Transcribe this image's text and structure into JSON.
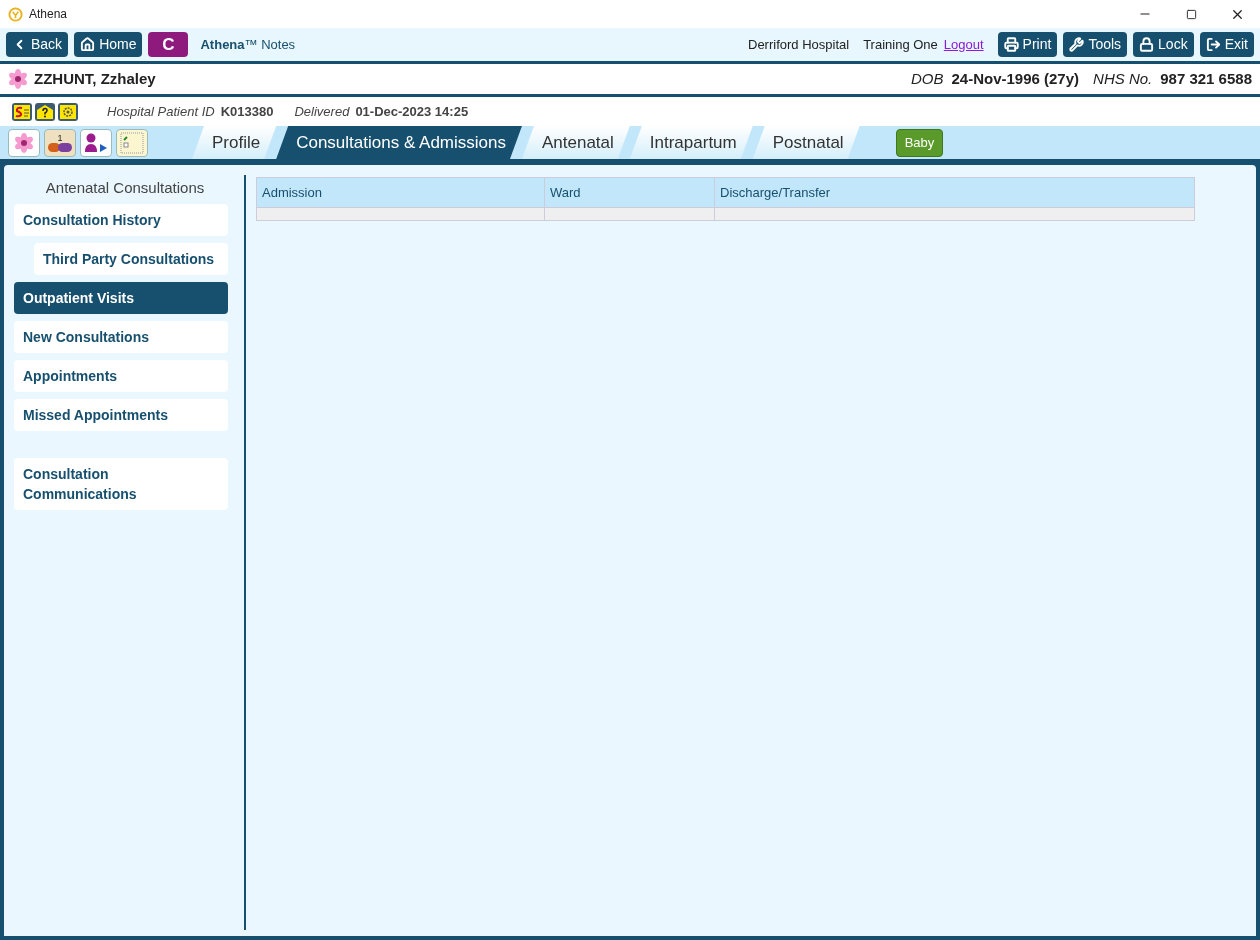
{
  "window": {
    "title": "Athena"
  },
  "toolbar": {
    "left_buttons": [
      {
        "kind": "back",
        "label": "Back"
      },
      {
        "kind": "home",
        "label": "Home"
      },
      {
        "kind": "letter",
        "label": "C"
      }
    ],
    "app_name": "**Athena**™ Notes",
    "hospital": "Derriford Hospital",
    "user": "Training One",
    "logout": "Logout",
    "right_buttons": [
      {
        "kind": "print",
        "label": "Print"
      },
      {
        "kind": "tools",
        "label": "Tools"
      },
      {
        "kind": "lock",
        "label": "Lock"
      },
      {
        "kind": "exit",
        "label": "Exit"
      }
    ]
  },
  "patient": {
    "name": "ZZHUNT, Zzhaley",
    "dob_label": "DOB",
    "dob": "24-Nov-1996 (27y)",
    "nhs_label": "NHS No.",
    "nhs": "987 321 6588",
    "id_label": "Hospital Patient ID",
    "id": "K013380",
    "delivered_label": "Delivered",
    "delivered": "01-Dec-2023 14:25"
  },
  "quick_icons": [
    {
      "kind": "flower"
    },
    {
      "kind": "pills",
      "count": "1"
    },
    {
      "kind": "person"
    },
    {
      "kind": "notepad"
    }
  ],
  "tabs": [
    {
      "label": "Profile",
      "selected": false
    },
    {
      "label": "Consultations & Admissions",
      "selected": true
    },
    {
      "label": "Antenatal",
      "selected": false
    },
    {
      "label": "Intrapartum",
      "selected": false
    },
    {
      "label": "Postnatal",
      "selected": false
    }
  ],
  "baby_button": "Baby",
  "sidebar": {
    "title": "Antenatal Consultations",
    "groups": [
      [
        {
          "label": "Consultation History",
          "indented": false,
          "selected": false
        },
        {
          "label": "Third Party Consultations",
          "indented": true,
          "selected": false
        },
        {
          "label": "Outpatient Visits",
          "indented": false,
          "selected": true
        },
        {
          "label": "New Consultations",
          "indented": false,
          "selected": false
        },
        {
          "label": "Appointments",
          "indented": false,
          "selected": false
        },
        {
          "label": "Missed Appointments",
          "indented": false,
          "selected": false
        }
      ],
      [
        {
          "label": "Consultation Communications",
          "indented": false,
          "selected": false
        }
      ]
    ]
  },
  "table": {
    "columns": [
      "Admission",
      "Ward",
      "Discharge/Transfer"
    ]
  }
}
